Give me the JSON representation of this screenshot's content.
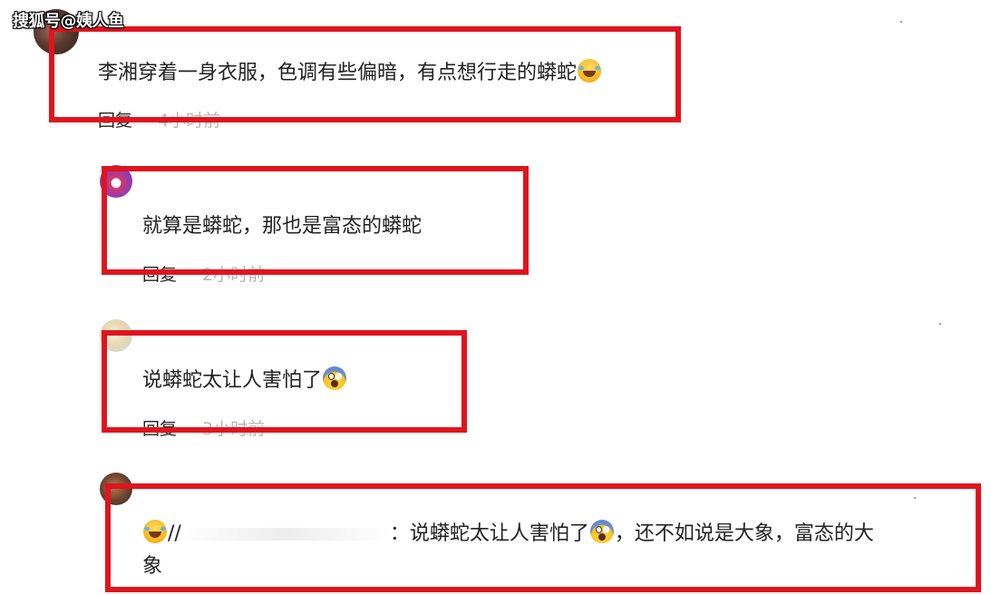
{
  "watermark": "搜狐号@姨人鱼",
  "comments": [
    {
      "text": "李湘穿着一身衣服，色调有些偏暗，有点想行走的蟒蛇",
      "emoji": "laughing-tears",
      "reply_label": "回复",
      "time": "4小时前"
    },
    {
      "text": "就算是蟒蛇，那也是富态的蟒蛇",
      "reply_label": "回复",
      "time": "2小时前"
    },
    {
      "text": "说蟒蛇太让人害怕了",
      "emoji": "screaming-face",
      "reply_label": "回复",
      "time": "3小时前"
    },
    {
      "prefix": "//",
      "text_part1": "：说蟒蛇太让人害怕了",
      "text_part2": "，还不如说是大象，富态的大",
      "text_line2": "象"
    }
  ],
  "colors": {
    "highlight": "#e0141e",
    "text": "#222222",
    "time": "#b5b5b5"
  }
}
